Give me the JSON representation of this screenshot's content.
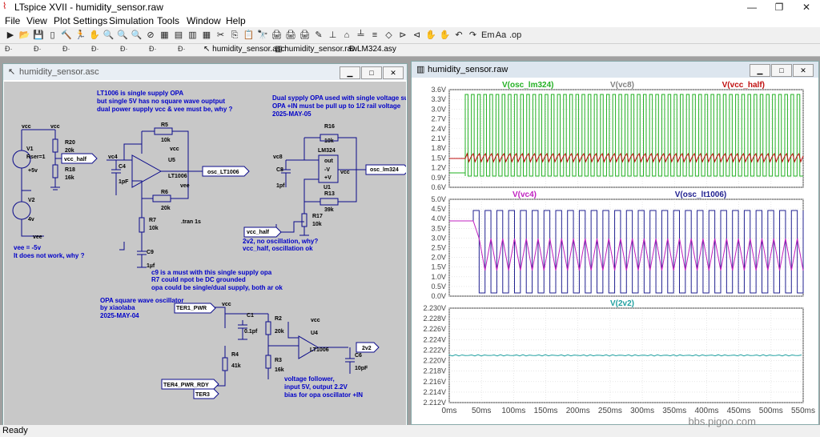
{
  "window": {
    "title": "LTspice XVII - humidity_sensor.raw",
    "min": "—",
    "max": "❐",
    "close": "✕"
  },
  "menus": [
    "File",
    "View",
    "Plot Settings",
    "Simulation",
    "Tools",
    "Window",
    "Help"
  ],
  "toolbar_icons": [
    "▶",
    "📂",
    "💾",
    "▯",
    "🔨",
    "🏃",
    "✋",
    "🔍",
    "🔍",
    "🔍",
    "⊘",
    "▦",
    "▤",
    "▥",
    "▦",
    "✂",
    "⎘",
    "📋",
    "🔭",
    "🖨",
    "🖨",
    "🖨",
    "✎",
    "⊥",
    "⌂",
    "╧",
    "≡",
    "◇",
    "⊳",
    "⊲",
    "✋",
    "✋",
    "↶",
    "↷",
    "Em",
    "Aa",
    ".op"
  ],
  "tabs": [
    {
      "label": "humidity_sensor.asc"
    },
    {
      "label": "humidity_sensor.raw"
    },
    {
      "label": "LM324.asy"
    }
  ],
  "schematic_window": {
    "title": "humidity_sensor.asc",
    "btn_min": "▁",
    "btn_max": "□",
    "btn_close": "✕"
  },
  "waveform_window": {
    "title": "humidity_sensor.raw",
    "btn_min": "▁",
    "btn_max": "□",
    "btn_close": "✕"
  },
  "schematic": {
    "notes": {
      "lt1006_1": "LT1006 is single supply OPA",
      "lt1006_2": "but single 5V has no square wave ouptput",
      "lt1006_3": "dual power supply vcc & vee must be, why ?",
      "dual_1": "Dual sypply OPA used with single voltage supp",
      "dual_2": "OPA +IN must be pull up to 1/2 rail voltage",
      "dual_3": "2025-MAY-05",
      "vee_1": "vee = -5v",
      "vee_2": "It does not work, why ?",
      "c9_1": "c9 is a must with this single supply opa",
      "c9_2": "R7 could npot be DC grounded",
      "c9_3": "opa could be single/dual supply, both ar ok",
      "sq_1": "OPA square wave oscillator",
      "sq_2": "by xiaolaba",
      "sq_3": "2025-MAY-04",
      "nooc_1": "2v2, no oscillation, why?",
      "nooc_2": "vcc_half, oscillation ok",
      "vf_1": "voltage follower,",
      "vf_2": "input 5V, output 2.2V",
      "vf_3": "bias for opa oscillator +IN"
    },
    "labels": {
      "vcc1": "vcc",
      "vcc2": "vcc",
      "vcc3": "vcc",
      "vcc4": "vcc",
      "vcc5": "vcc",
      "vcc6": "vcc",
      "v1": "V1",
      "rser": "Rser=1",
      "v1val": "+5v",
      "v2": "V2",
      "v2val": "4v",
      "vee1": "vee",
      "vee2": "vee",
      "r20": "R20",
      "r20v": "20k",
      "r18": "R18",
      "r18v": "16k",
      "vcchalf": "vcc_half",
      "r5": "R5",
      "r5v": "10k",
      "vc4": "vc4",
      "c4": "C4",
      "c4v": "1pF",
      "u5": "U5",
      "u5t": "LT1006",
      "r6": "R6",
      "r6v": "20k",
      "r7": "R7",
      "r7v": "10k",
      "tran": ".tran 1s",
      "c9": "C9",
      "c9v": "1µf",
      "osclt": "osc_LT1006",
      "r16": "R16",
      "r16v": "10k",
      "lm324": "LM324",
      "vc8": "vc8",
      "c8": "C8",
      "c8v": "1pf",
      "u1": "U1",
      "out": "out",
      "minv": "-V",
      "plusv": "+V",
      "oscl": "osc_lm324",
      "r13": "R13",
      "r13v": "39k",
      "r17": "R17",
      "r17v": "10k",
      "vcchalf2": "vcc_half",
      "ter1": "TER1_PWR",
      "c1": "C1",
      "c1v": "0.1pf",
      "r2": "R2",
      "r2v": "20k",
      "u4": "U4",
      "u4t": "LT1006",
      "v2v2": "2v2",
      "r4": "R4",
      "r4v": "41k",
      "r3": "R3",
      "r3v": "16k",
      "c6": "C6",
      "c6v": "10pF",
      "ter4": "TER4_PWR_RDY",
      "ter3": "TER3"
    }
  },
  "waveform": {
    "pane1": {
      "traces": [
        {
          "name": "V(osc_lm324)",
          "color": "#22b022"
        },
        {
          "name": "V(vc8)",
          "color": "#808080"
        },
        {
          "name": "V(vcc_half)",
          "color": "#c01010"
        }
      ],
      "yticks": [
        "3.6V",
        "3.3V",
        "3.0V",
        "2.7V",
        "2.4V",
        "2.1V",
        "1.8V",
        "1.5V",
        "1.2V",
        "0.9V",
        "0.6V"
      ],
      "high": 3.6,
      "low": 0.6,
      "bias": 1.3
    },
    "pane2": {
      "traces": [
        {
          "name": "V(vc4)",
          "color": "#c020c0"
        },
        {
          "name": "V(osc_lt1006)",
          "color": "#202090"
        }
      ],
      "yticks": [
        "5.0V",
        "4.5V",
        "4.0V",
        "3.5V",
        "3.0V",
        "2.5V",
        "2.0V",
        "1.5V",
        "1.0V",
        "0.5V",
        "0.0V"
      ]
    },
    "pane3": {
      "traces": [
        {
          "name": "V(2v2)",
          "color": "#20a0a0"
        }
      ],
      "yticks": [
        "2.230V",
        "2.228V",
        "2.226V",
        "2.224V",
        "2.222V",
        "2.220V",
        "2.218V",
        "2.216V",
        "2.214V",
        "2.212V"
      ],
      "value": 2.2214
    },
    "xticks": [
      "0ms",
      "50ms",
      "100ms",
      "150ms",
      "200ms",
      "250ms",
      "300ms",
      "350ms",
      "400ms",
      "450ms",
      "500ms",
      "550ms"
    ]
  },
  "status": "Ready",
  "watermark": "bbs.pigoo.com"
}
